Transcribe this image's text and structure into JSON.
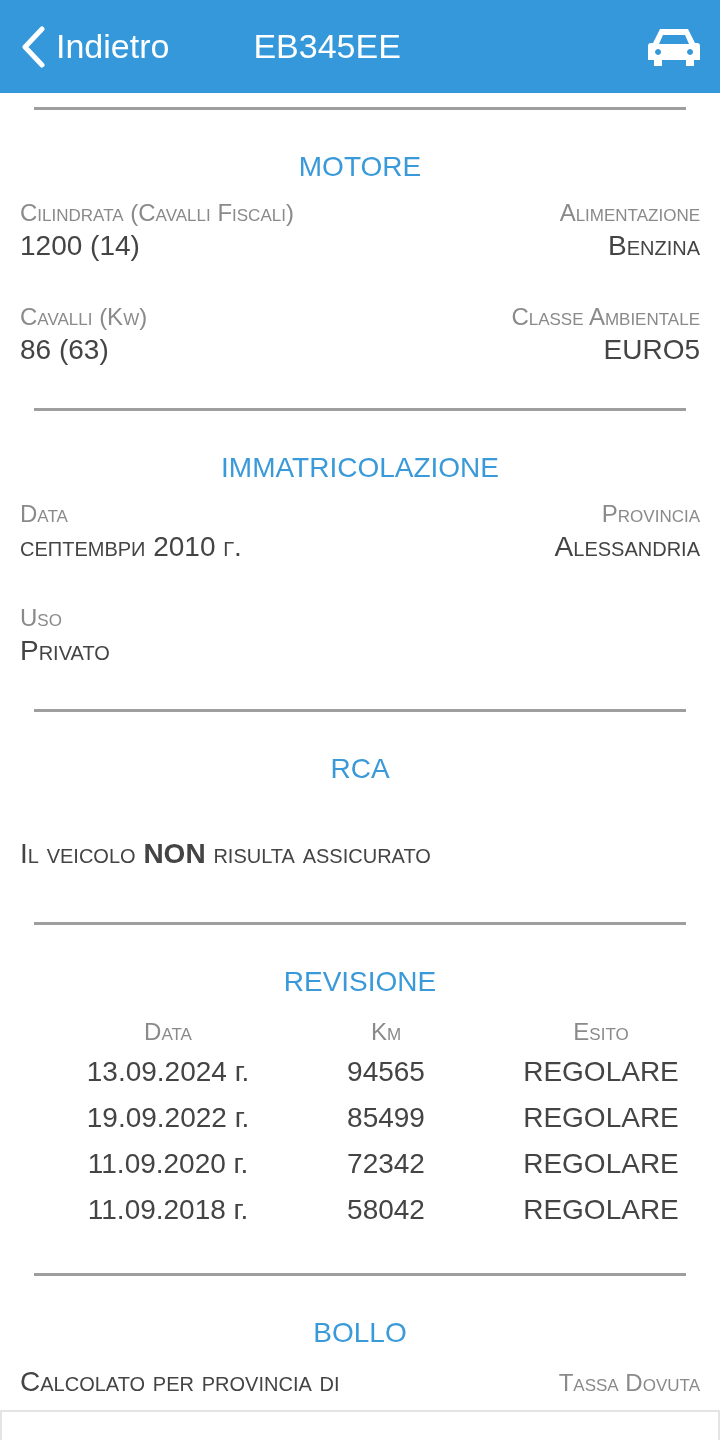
{
  "header": {
    "back_label": "Indietro",
    "title": "EB345EE"
  },
  "sections": [
    {
      "kind": "fields",
      "title": "MOTORE",
      "rows": [
        [
          {
            "label": "Cilindrata (Cavalli Fiscali)",
            "value": "1200 (14)"
          },
          {
            "label": "Alimentazione",
            "value": "Benzina"
          }
        ],
        [
          {
            "label": "Cavalli (Kw)",
            "value": "86 (63)"
          },
          {
            "label": "Classe Ambientale",
            "value": "EURO5"
          }
        ]
      ]
    },
    {
      "kind": "fields",
      "title": "IMMATRICOLAZIONE",
      "rows": [
        [
          {
            "label": "Data",
            "value": "септември 2010 г."
          },
          {
            "label": "Provincia",
            "value": "Alessandria"
          }
        ],
        [
          {
            "label": "Uso",
            "value": "Privato"
          }
        ]
      ]
    },
    {
      "kind": "text",
      "title": "RCA",
      "text": "Il veicolo **NON** risulta assicurato"
    },
    {
      "kind": "table",
      "title": "REVISIONE",
      "columns": [
        "Data",
        "Km",
        "Esito"
      ],
      "rows": [
        [
          "13.09.2024 г.",
          "94565",
          "REGOLARE"
        ],
        [
          "19.09.2022 г.",
          "85499",
          "REGOLARE"
        ],
        [
          "11.09.2020 г.",
          "72342",
          "REGOLARE"
        ],
        [
          "11.09.2018 г.",
          "58042",
          "REGOLARE"
        ]
      ]
    },
    {
      "kind": "bollo",
      "title": "BOLLO",
      "left": "Calcolato per provincia di",
      "right": "Tassa Dovuta"
    }
  ]
}
